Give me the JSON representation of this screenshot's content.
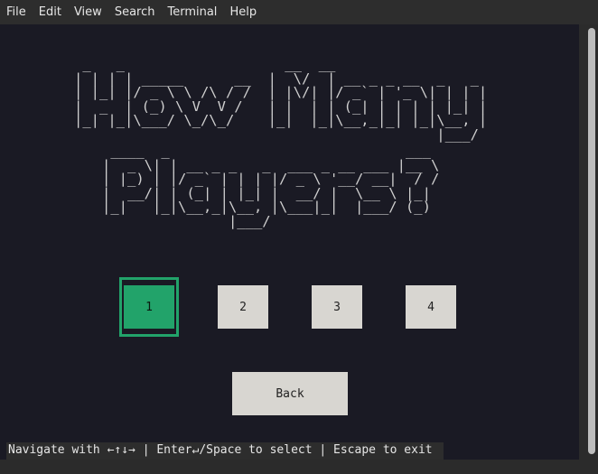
{
  "menubar": {
    "items": [
      "File",
      "Edit",
      "View",
      "Search",
      "Terminal",
      "Help"
    ]
  },
  "ascii_art": {
    "line1": " _   _                   __  __                    \n| | | | _____      __  |  \\/  | __ _ _ __  _   _ \n| |_| |/ _ \\ \\ /\\ / /  | |\\/| |/ _` | '_ \\| | | |\n|  _  | (_) \\ V  V /   | |  | | (_| | | | | |_| |\n|_| |_|\\___/ \\_/\\_/    |_|  |_|\\__,_|_| |_|\\__, |\n                                           |___/ ",
    "line2": " ____  _                            ___ \n|  _ \\| | __ _ _   _  ___ _ __ ___ |__ \\\n| |_) | |/ _` | | | |/ _ \\ '__/ __|  / /\n|  __/| | (_| | |_| |  __/ |  \\__ \\ |_| \n|_|   |_|\\__,_|\\__, |\\___|_|  |___/ (_) \n               |___/                    "
  },
  "options": [
    "1",
    "2",
    "3",
    "4"
  ],
  "selected_option": "1",
  "back_label": "Back",
  "status_bar": "Navigate with ←↑↓→ | Enter↵/Space to select | Escape to exit",
  "colors": {
    "terminal_bg": "#1a1a24",
    "accent": "#22a36a",
    "button_bg": "#d8d6d1",
    "ascii_fg": "#cfcfcf"
  }
}
